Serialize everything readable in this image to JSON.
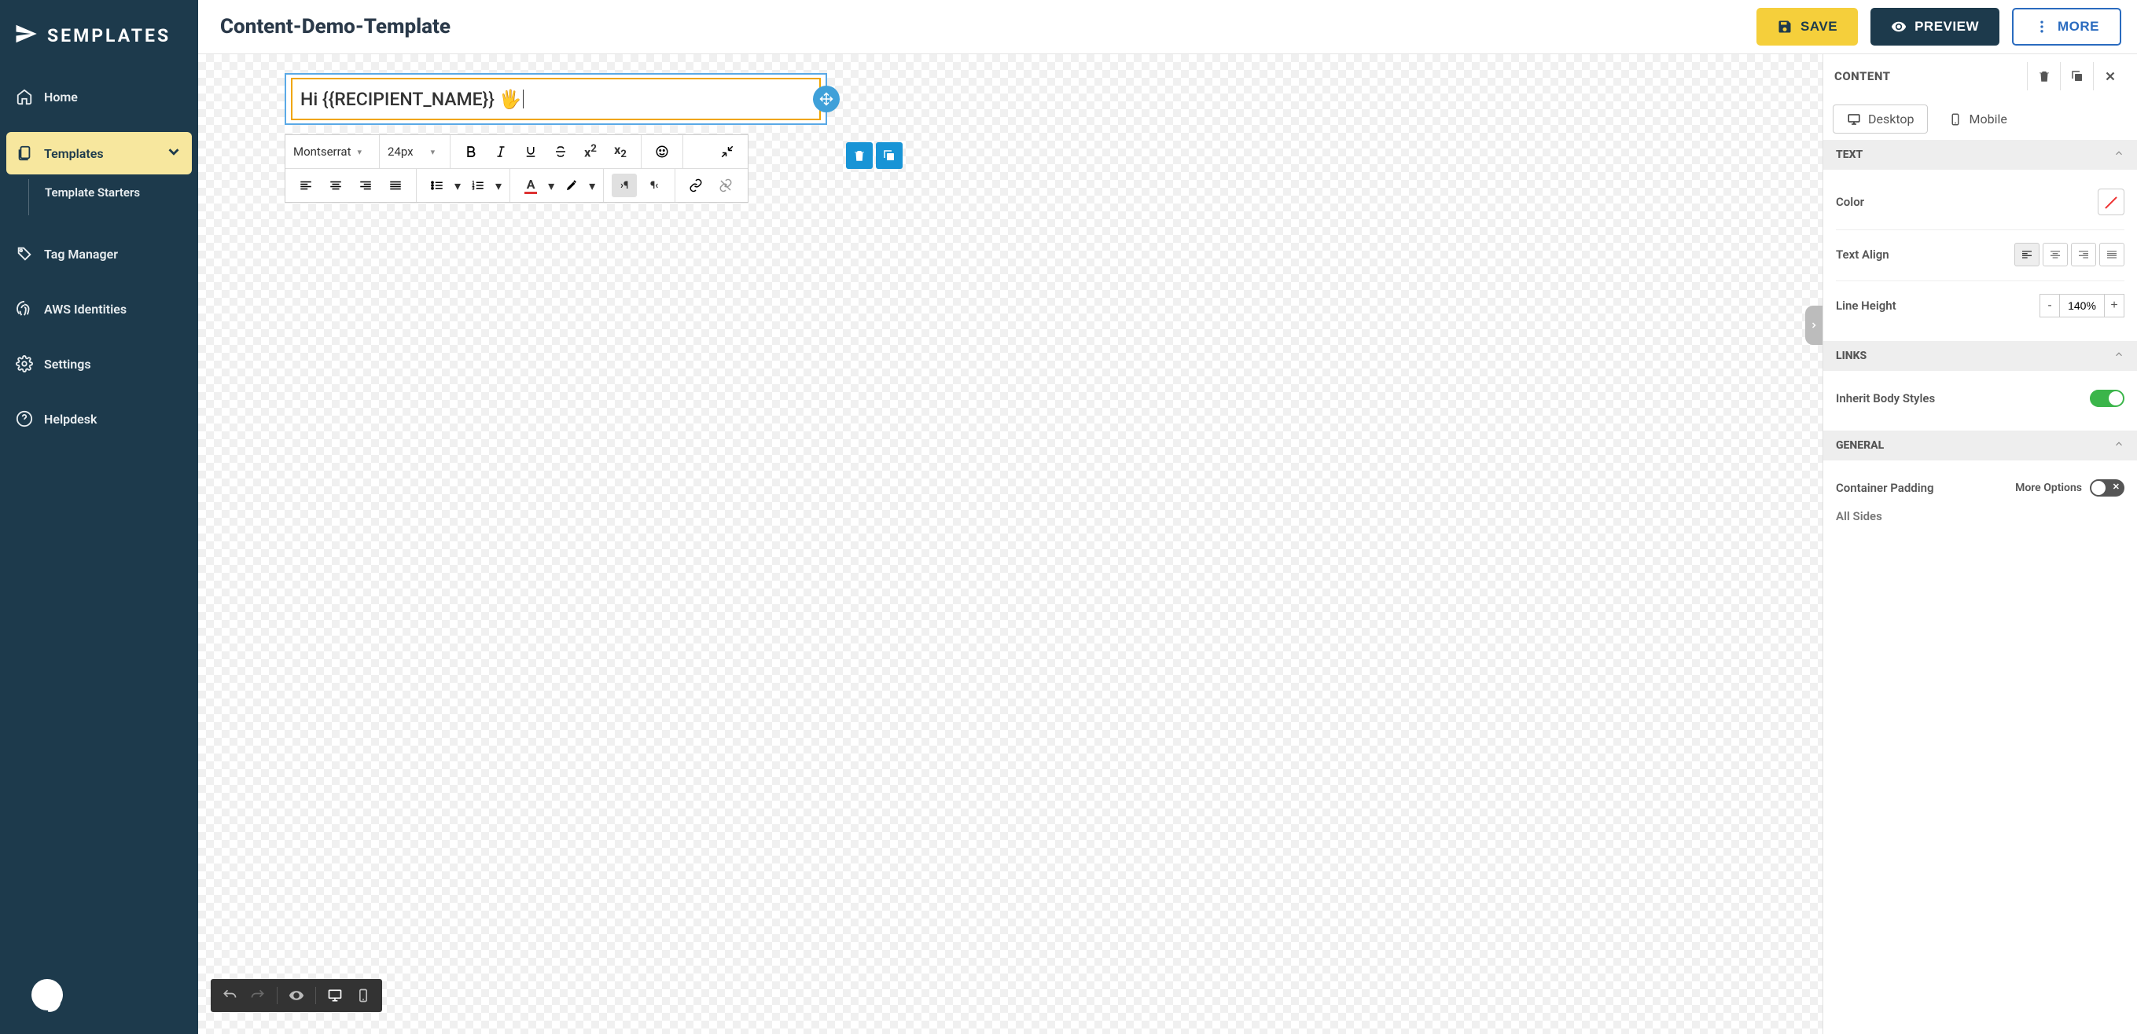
{
  "brand": "SEMPLATES",
  "sidebar": {
    "items": [
      {
        "label": "Home",
        "icon": "home"
      },
      {
        "label": "Templates",
        "icon": "templates",
        "active": true,
        "expanded": true
      },
      {
        "label": "Tag Manager",
        "icon": "tag"
      },
      {
        "label": "AWS Identities",
        "icon": "fingerprint"
      },
      {
        "label": "Settings",
        "icon": "gear"
      },
      {
        "label": "Helpdesk",
        "icon": "help"
      }
    ],
    "sub": {
      "label": "Template Starters"
    }
  },
  "header": {
    "title": "Content-Demo-Template",
    "save": "SAVE",
    "preview": "PREVIEW",
    "more": "MORE"
  },
  "editor": {
    "block_text": "Hi {{RECIPIENT_NAME}} 🖐",
    "font_family": "Montserrat",
    "font_size": "24px"
  },
  "panel": {
    "title": "CONTENT",
    "tabs": {
      "desktop": "Desktop",
      "mobile": "Mobile"
    },
    "sections": {
      "text": {
        "title": "TEXT",
        "color_label": "Color",
        "align_label": "Text Align",
        "lineheight_label": "Line Height",
        "lineheight_value": "140%"
      },
      "links": {
        "title": "LINKS",
        "inherit_label": "Inherit Body Styles"
      },
      "general": {
        "title": "GENERAL",
        "container_padding": "Container Padding",
        "more_options": "More Options",
        "all_sides": "All Sides"
      }
    }
  }
}
